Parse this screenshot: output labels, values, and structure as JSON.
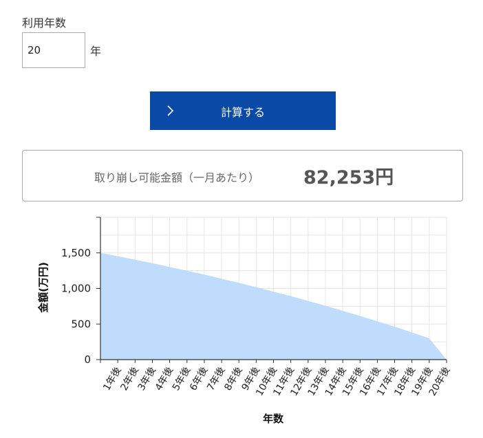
{
  "form": {
    "years_label": "利用年数",
    "years_value": "20",
    "years_unit": "年",
    "calculate_label": "計算する"
  },
  "result": {
    "label": "取り崩し可能金額（一月あたり）",
    "value": "82,253円"
  },
  "colors": {
    "button": "#0a4aa6",
    "area_fill": "#c0dcfc",
    "text": "#333333"
  },
  "chart_data": {
    "type": "area",
    "xlabel": "年数",
    "ylabel": "金額(万円)",
    "ylim": [
      0,
      2000
    ],
    "yticks": [
      0,
      500,
      1000,
      1500
    ],
    "ytick_labels": [
      "0",
      "500",
      "1,000",
      "1,500"
    ],
    "grid": true,
    "categories": [
      "",
      "1年後",
      "2年後",
      "3年後",
      "4年後",
      "5年後",
      "6年後",
      "7年後",
      "8年後",
      "9年後",
      "10年後",
      "11年後",
      "12年後",
      "13年後",
      "14年後",
      "15年後",
      "16年後",
      "17年後",
      "18年後",
      "19年後",
      "20年後"
    ],
    "values": [
      1500,
      1453,
      1404,
      1354,
      1302,
      1249,
      1194,
      1137,
      1078,
      1018,
      955,
      891,
      825,
      757,
      686,
      614,
      539,
      462,
      382,
      300,
      0
    ]
  }
}
